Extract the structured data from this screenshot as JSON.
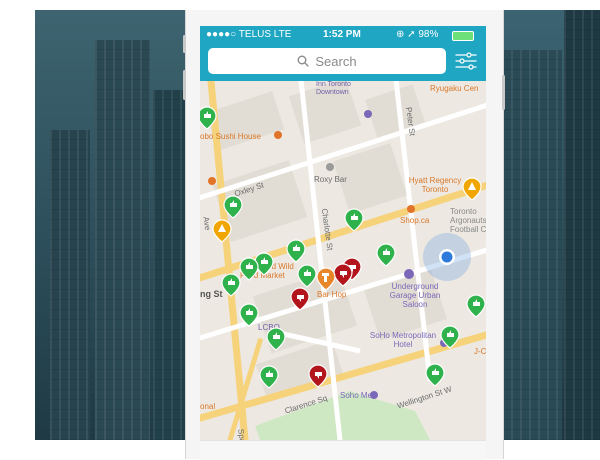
{
  "status_bar": {
    "carrier": "●●●●○ TELUS  LTE",
    "time": "1:52 PM",
    "battery": "⊕ ➚ 98%"
  },
  "search": {
    "label": "Search",
    "icon": "search-icon",
    "filter_icon": "filter-sliders-icon"
  },
  "map": {
    "street_labels": [
      "Oxley St",
      "Charlotte St",
      "Peter St",
      "Clarence Sq",
      "Wellington St W",
      "Spadina",
      "ng St",
      "Ave"
    ],
    "poi_labels": [
      "Inn Toronto Downtown",
      "Ryugaku Cen",
      "obo Sushi House",
      "Roxy Bar",
      "Hyatt Regency Toronto",
      "Shop.ca",
      "Toronto Argonauts Football C",
      "Fresh and Wild Food Market",
      "Bar Hop",
      "Underground Garage Urban Saloon",
      "LCBO",
      "SoHo Metropolitan Hotel",
      "J-C F",
      "Soho Met",
      "onal"
    ],
    "colors": {
      "positive_pin": "#2fb24c",
      "negative_pin": "#b3151c",
      "neutral_pin": "#f0a500",
      "location_dot": "#2f7bdc",
      "park": "#cfe8c4",
      "road_major": "#f6d27a",
      "header": "#1fa6c2"
    }
  }
}
